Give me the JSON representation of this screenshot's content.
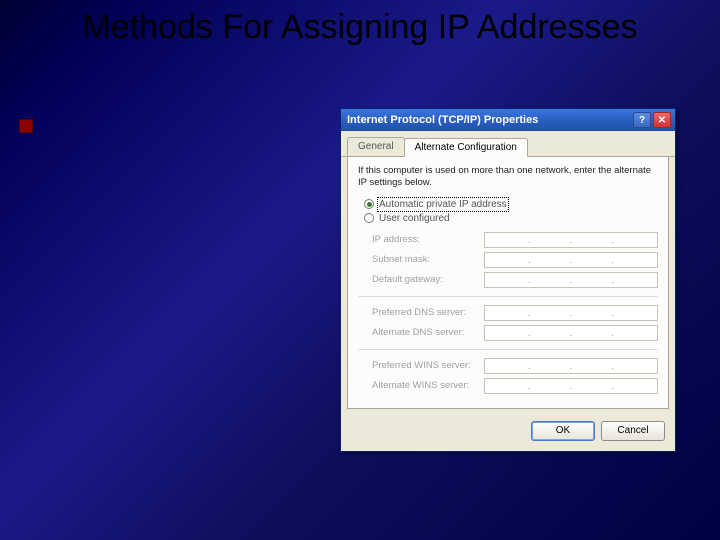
{
  "slide": {
    "title": "Methods For Assigning IP Addresses"
  },
  "dialog": {
    "title": "Internet Protocol (TCP/IP) Properties",
    "help_char": "?",
    "close_char": "✕",
    "tabs": {
      "general": "General",
      "alt": "Alternate Configuration"
    },
    "intro": "If this computer is used on more than one network, enter the alternate IP settings below.",
    "radios": {
      "auto": "Automatic private IP address",
      "user": "User configured"
    },
    "labels": {
      "ip": "IP address:",
      "subnet": "Subnet mask:",
      "gateway": "Default gateway:",
      "pdns": "Preferred DNS server:",
      "adns": "Alternate DNS server:",
      "pwins": "Preferred WINS server:",
      "awins": "Alternate WINS server:"
    },
    "buttons": {
      "ok": "OK",
      "cancel": "Cancel"
    }
  }
}
